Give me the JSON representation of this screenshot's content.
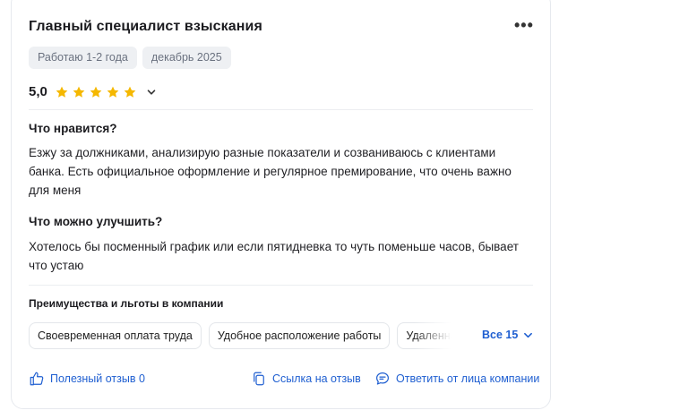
{
  "review": {
    "title": "Главный специалист взыскания",
    "more_icon": "more-icon",
    "tags": [
      "Работаю 1-2 года",
      "декабрь 2025"
    ],
    "rating": {
      "value_label": "5,0",
      "value": 5,
      "max": 5,
      "star_color": "#f5b800"
    },
    "likes": {
      "heading": "Что нравится?",
      "text": "Езжу за должниками, анализирую разные показатели и созваниваюсь с клиентами банка. Есть официальное оформление и регулярное премирование, что очень важно для меня"
    },
    "improve": {
      "heading": "Что можно улучшить?",
      "text": "Хотелось бы посменный график или если пятидневка то чуть поменьше часов, бывает что устаю"
    },
    "benefits": {
      "heading": "Преимущества и льготы в компании",
      "items": [
        "Своевременная оплата труда",
        "Удобное расположение работы",
        "Удаленная работа"
      ],
      "see_all_label": "Все 15"
    },
    "actions": {
      "helpful_label": "Полезный отзыв 0",
      "link_label": "Ссылка на отзыв",
      "reply_label": "Ответить от лица компании"
    }
  },
  "colors": {
    "accent": "#1f5fd1",
    "primary_button": "#0d6efd",
    "tag_bg": "#eef0f3"
  }
}
